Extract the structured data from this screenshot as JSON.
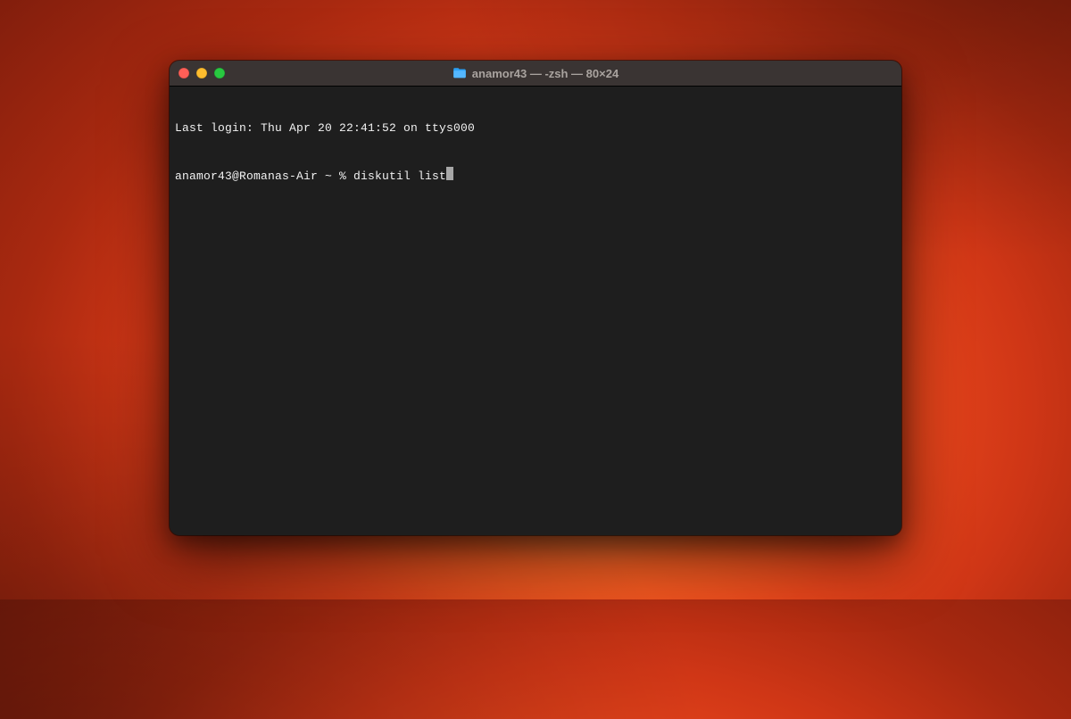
{
  "window": {
    "title": "anamor43 — -zsh — 80×24",
    "traffic_lights": {
      "close": "close",
      "minimize": "minimize",
      "zoom": "zoom"
    },
    "folder_icon": "folder-icon"
  },
  "terminal": {
    "last_login_line": "Last login: Thu Apr 20 22:41:52 on ttys000",
    "prompt": "anamor43@Romanas-Air ~ % ",
    "command": "diskutil list"
  },
  "colors": {
    "window_bg": "#1e1e1e",
    "title_bar": "#3a3433",
    "text": "#f2f2f2",
    "close": "#ff5f57",
    "minimize": "#febc2e",
    "zoom": "#28c840"
  }
}
